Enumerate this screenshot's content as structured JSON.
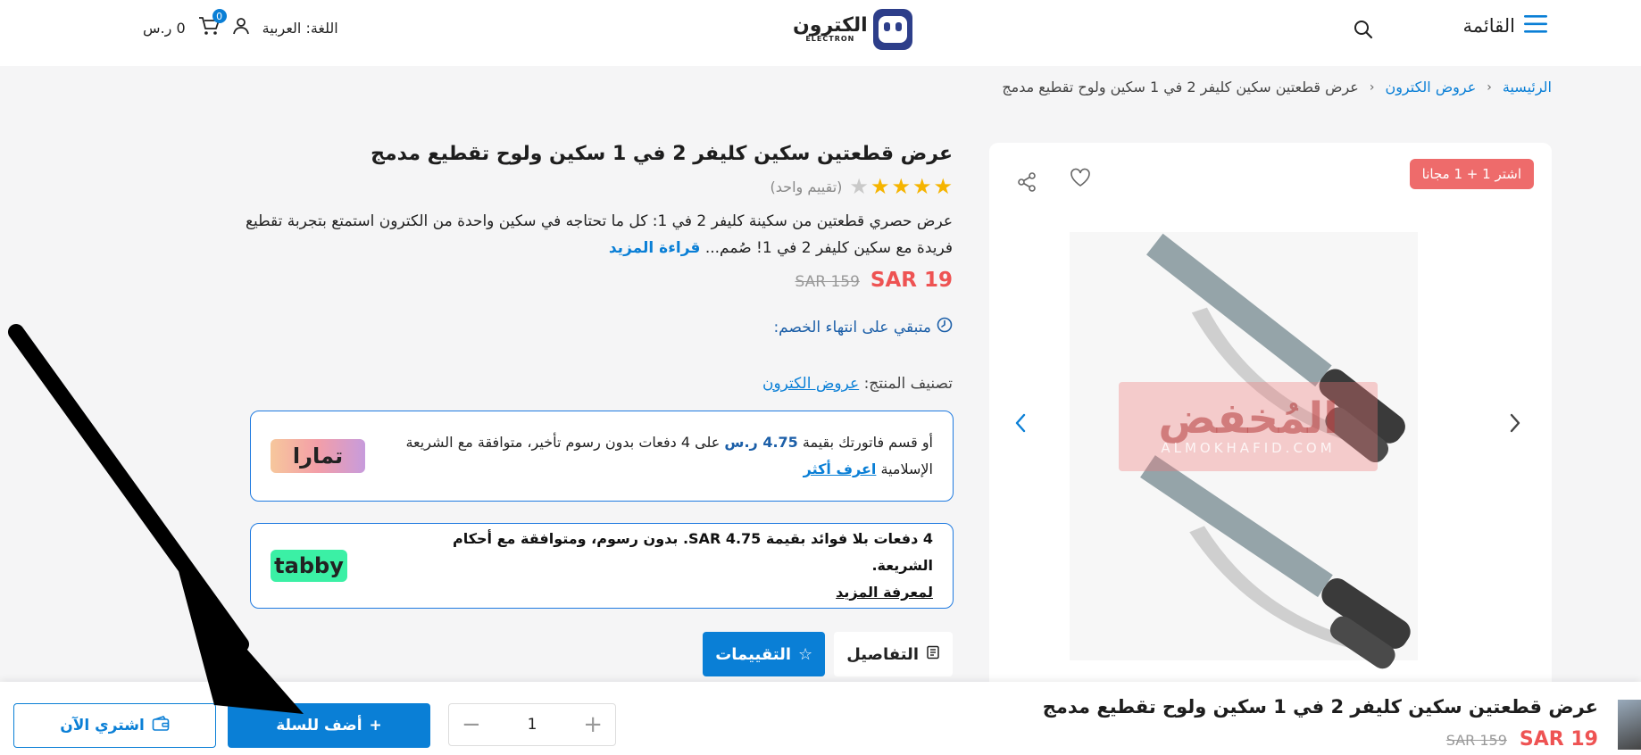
{
  "header": {
    "menu_label": "القائمة",
    "logo_ar": "الكترون",
    "logo_en": "ELECTRON",
    "language_label": "اللغة: العربية",
    "cart_count": "0",
    "cart_total": "0 ر.س"
  },
  "breadcrumb": {
    "home": "الرئيسية",
    "category": "عروض الكترون",
    "current": "عرض قطعتين سكين كليفر 2 في 1 سكين ولوح تقطيع مدمج"
  },
  "gallery": {
    "promo_badge": "اشتر 1 + 1 مجانا",
    "watermark_ar": "المُخفض",
    "watermark_en": "ALMOKHAFID.COM"
  },
  "product": {
    "title": "عرض قطعتين سكين كليفر 2 في 1 سكين ولوح تقطيع مدمج",
    "rating": 4,
    "rating_max": 5,
    "rating_count": "(تقييم واحد)",
    "description": "عرض حصري قطعتين من سكينة كليفر 2 في 1: كل ما تحتاجه في سكين واحدة من الكترون استمتع بتجربة تقطيع فريدة مع سكين كليفر 2 في 1! صُمم...",
    "read_more": "قراءة المزيد",
    "price_now": "SAR 19",
    "price_old": "SAR 159",
    "countdown_label": "متبقي على انتهاء الخصم:",
    "category_label": "تصنيف المنتج:",
    "category_value": "عروض الكترون"
  },
  "tamara": {
    "text_pre": "أو قسم فاتورتك بقيمة",
    "amount": "4.75 ر.س",
    "text_post": "على 4 دفعات بدون رسوم تأخير، متوافقة مع الشريعة الإسلامية",
    "link": "اعرف أكثر",
    "logo": "تمارا"
  },
  "tabby": {
    "text": "4 دفعات بلا فوائد بقيمة SAR 4.75. بدون رسوم، ومتوافقة مع أحكام الشريعة.",
    "link": "لمعرفة المزيد",
    "logo": "tabby"
  },
  "tabs": {
    "details": "التفاصيل",
    "reviews": "التقييمات"
  },
  "bottom_bar": {
    "title": "عرض قطعتين سكين كليفر 2 في 1 سكين ولوح تقطيع مدمج",
    "price_now": "SAR 19",
    "price_old": "SAR 159",
    "quantity": "1",
    "add_to_cart": "أضف للسلة",
    "buy_now": "اشتري الآن"
  },
  "colors": {
    "accent": "#0a7fd6",
    "sale": "#ee5353",
    "promo": "#ee6b6b"
  }
}
